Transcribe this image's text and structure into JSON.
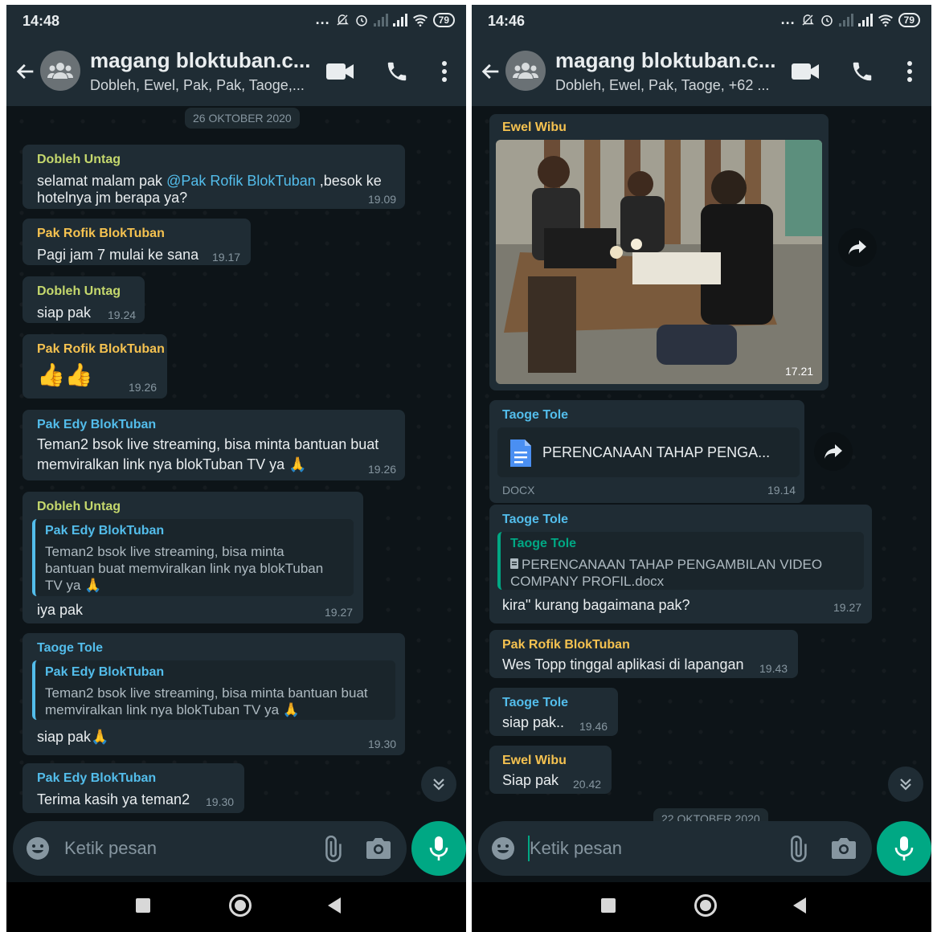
{
  "screens": [
    {
      "status": {
        "time": "14:48",
        "battery": "79",
        "dots": "..."
      },
      "header": {
        "title": "magang bloktuban.c...",
        "subtitle": "Dobleh, Ewel, Pak, Pak, Taoge,..."
      },
      "date_chip": "26 OKTOBER 2020",
      "messages": [
        {
          "sender": "Dobleh Untag",
          "sender_color": "#c5d86d",
          "text_line1_a": "selamat malam pak ",
          "mention": "@Pak Rofik BlokTuban",
          "text_line1_b": " ,besok ke",
          "text_line2": "hotelnya jm berapa ya?",
          "time": "19.09"
        },
        {
          "sender": "Pak Rofik BlokTuban",
          "sender_color": "#f5c250",
          "text": "Pagi jam 7 mulai ke sana",
          "time": "19.17"
        },
        {
          "sender": "Dobleh Untag",
          "sender_color": "#c5d86d",
          "text": "siap pak",
          "time": "19.24"
        },
        {
          "sender": "Pak Rofik BlokTuban",
          "sender_color": "#f5c250",
          "emoji": "👍👍",
          "time": "19.26"
        },
        {
          "sender": "Pak Edy BlokTuban",
          "sender_color": "#53bdeb",
          "text_line1": "Teman2 bsok live streaming, bisa minta bantuan buat",
          "text_line2": "memviralkan link nya blokTuban TV ya 🙏",
          "time": "19.26"
        },
        {
          "sender": "Dobleh Untag",
          "sender_color": "#c5d86d",
          "quote_sender": "Pak Edy BlokTuban",
          "quote_line1": "Teman2 bsok live streaming, bisa minta",
          "quote_line2": "bantuan buat memviralkan link nya blokTuban",
          "quote_line3": "TV ya 🙏",
          "text": "iya pak",
          "time": "19.27"
        },
        {
          "sender": "Taoge Tole",
          "sender_color": "#53bdeb",
          "quote_sender": "Pak Edy BlokTuban",
          "quote_line1": "Teman2 bsok live streaming, bisa minta bantuan buat",
          "quote_line2": "memviralkan link nya blokTuban TV ya 🙏",
          "text": "siap pak🙏",
          "time": "19.30"
        },
        {
          "sender": "Pak Edy BlokTuban",
          "sender_color": "#53bdeb",
          "text": "Terima kasih ya teman2",
          "time": "19.30"
        }
      ],
      "composer": {
        "placeholder": "Ketik pesan"
      }
    },
    {
      "status": {
        "time": "14:46",
        "battery": "79",
        "dots": "..."
      },
      "header": {
        "title": "magang bloktuban.c...",
        "subtitle": "Dobleh, Ewel, Pak, Taoge, +62 ..."
      },
      "messages": [
        {
          "sender": "Ewel Wibu",
          "sender_color": "#f5c250",
          "type": "photo",
          "time": "17.21"
        },
        {
          "sender": "Taoge Tole",
          "sender_color": "#53bdeb",
          "doc_name": "PERENCANAAN TAHAP PENGA...",
          "doc_type": "DOCX",
          "time": "19.14"
        },
        {
          "sender": "Taoge Tole",
          "sender_color": "#53bdeb",
          "quote_sender": "Taoge Tole",
          "quote_line1": "PERENCANAAN TAHAP PENGAMBILAN VIDEO",
          "quote_line2": "COMPANY PROFIL.docx",
          "text": "kira\" kurang bagaimana pak?",
          "time": "19.27"
        },
        {
          "sender": "Pak Rofik BlokTuban",
          "sender_color": "#f5c250",
          "text": "Wes Topp tinggal aplikasi di lapangan",
          "time": "19.43"
        },
        {
          "sender": "Taoge Tole",
          "sender_color": "#53bdeb",
          "text": "siap pak..",
          "time": "19.46"
        },
        {
          "sender": "Ewel Wibu",
          "sender_color": "#f5c250",
          "text": "Siap pak",
          "time": "20.42"
        }
      ],
      "date_chip_partial": "22 OKTOBER 2020",
      "composer": {
        "placeholder": "Ketik pesan"
      }
    }
  ],
  "icons": [
    "back-arrow-icon",
    "group-avatar-icon",
    "video-call-icon",
    "phone-icon",
    "more-vert-icon",
    "emoji-icon",
    "attach-icon",
    "camera-icon",
    "mic-icon",
    "scroll-down-icon",
    "forward-icon",
    "document-icon"
  ],
  "colors": {
    "accent": "#00a884",
    "bubble": "#1f2c34",
    "background": "#0d1418",
    "mention": "#53bdeb"
  }
}
